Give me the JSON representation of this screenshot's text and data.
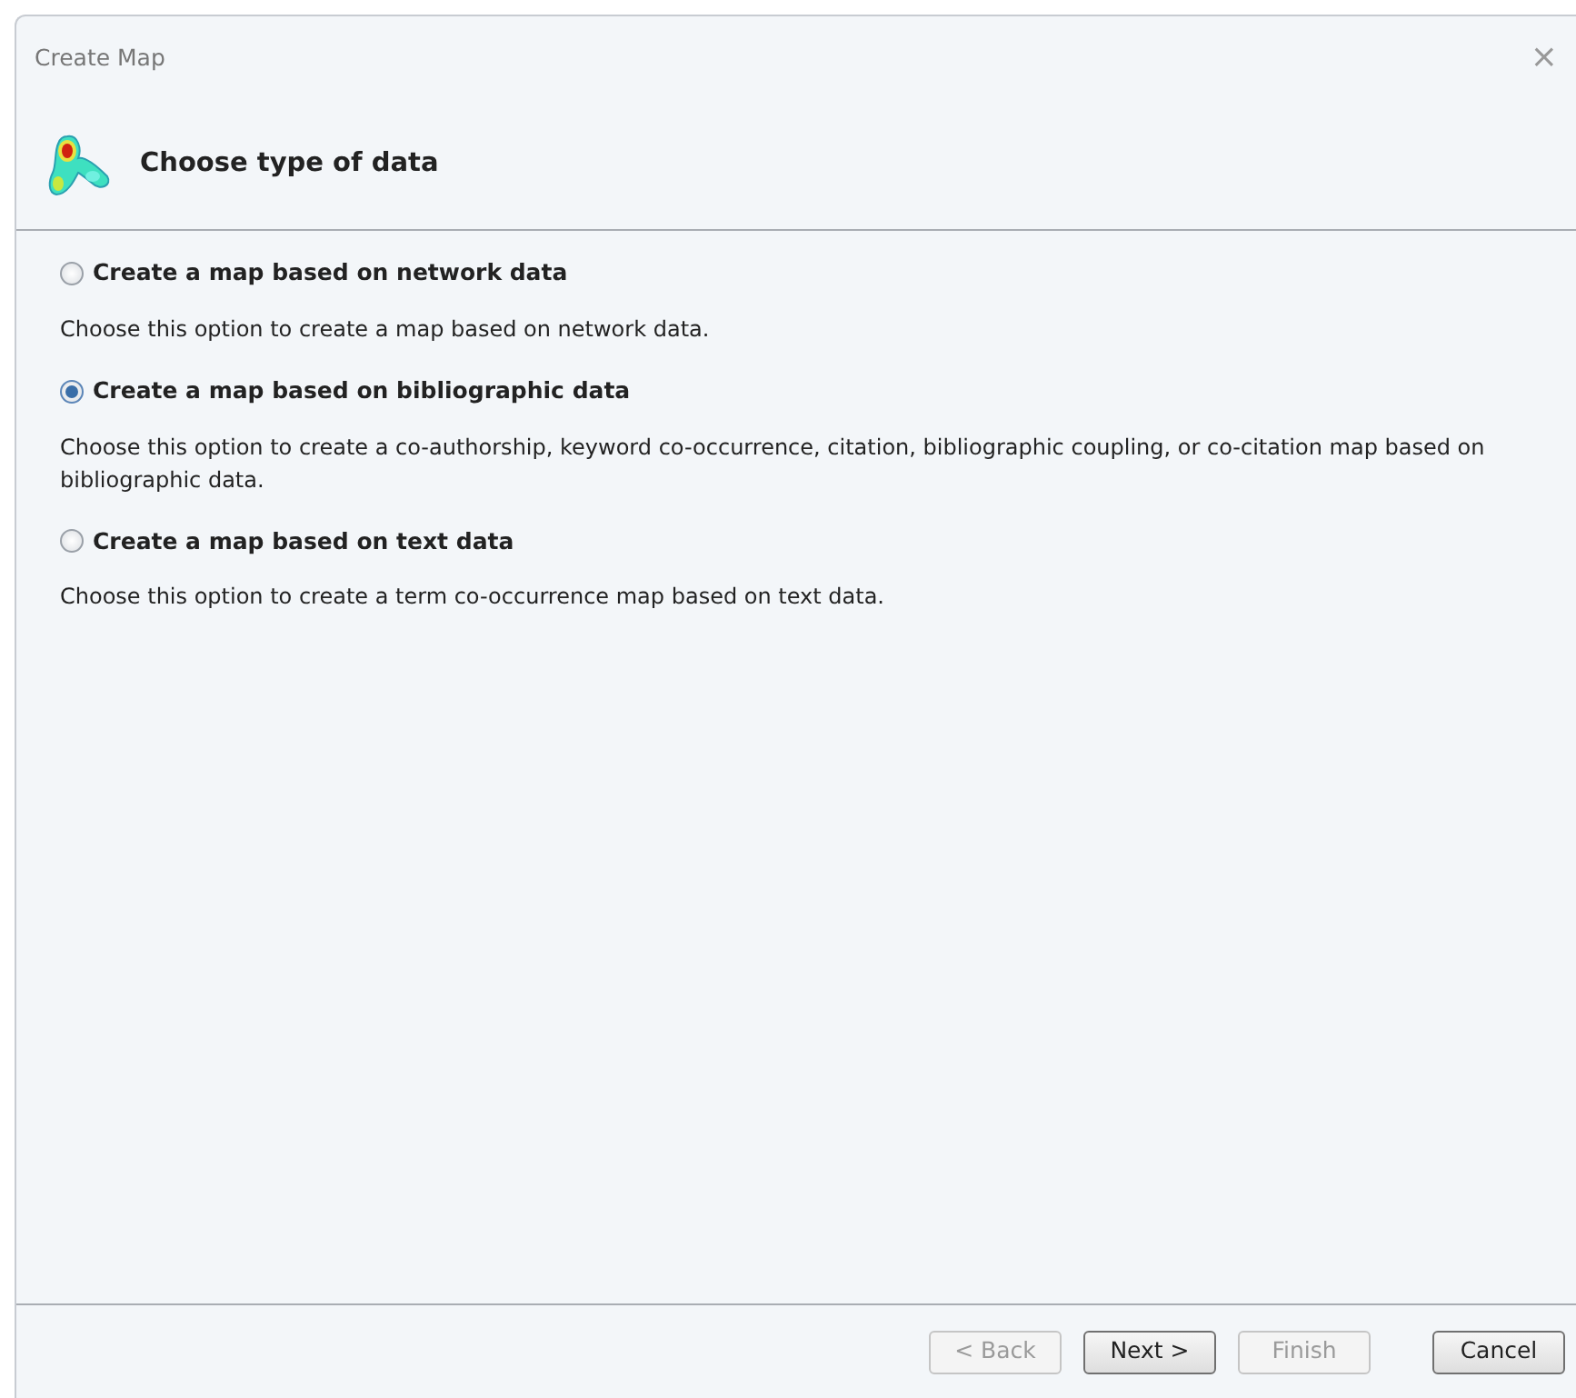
{
  "window": {
    "title": "Create Map",
    "close": "×"
  },
  "header": {
    "title": "Choose type of data"
  },
  "options": [
    {
      "label": "Create a map based on network data",
      "description": "Choose this option to create a map based on network data.",
      "selected": false
    },
    {
      "label": "Create a map based on bibliographic data",
      "description": "Choose this option to create a co-authorship, keyword co-occurrence, citation, bibliographic coupling, or co-citation map based on bibliographic data.",
      "selected": true
    },
    {
      "label": "Create a map based on text data",
      "description": "Choose this option to create a term co-occurrence map based on text data.",
      "selected": false
    }
  ],
  "buttons": [
    {
      "label": "< Back",
      "disabled": true
    },
    {
      "label": "Next >",
      "disabled": false
    },
    {
      "label": "Finish",
      "disabled": true
    },
    {
      "label": "Cancel",
      "disabled": false
    }
  ]
}
